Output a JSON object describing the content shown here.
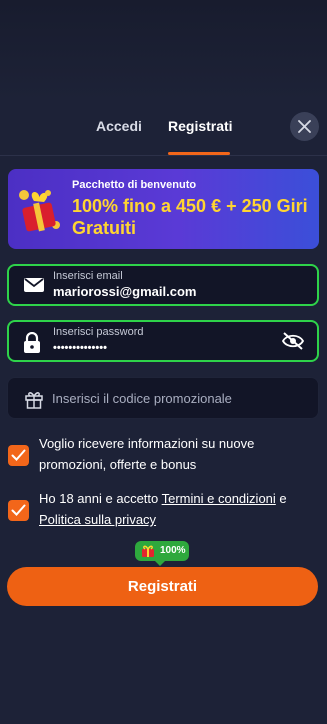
{
  "tabs": {
    "login_label": "Accedi",
    "register_label": "Registrati",
    "active": "register"
  },
  "promo": {
    "subtitle": "Pacchetto di benvenuto",
    "title": "100% fino a 450 € + 250 Giri Gratuiti"
  },
  "form": {
    "email": {
      "label": "Inserisci email",
      "value": "mariorossi@gmail.com"
    },
    "password": {
      "label": "Inserisci password",
      "value": "••••••••••••••"
    },
    "promo_code": {
      "placeholder": "Inserisci il codice promozionale"
    }
  },
  "consents": {
    "marketing_text": "Voglio ricevere informazioni su nuove promozioni, offerte e bonus",
    "terms_prefix": "Ho 18 anni e accetto ",
    "terms_link": "Termini e condizioni",
    "terms_and": " e ",
    "privacy_link": "Politica sulla privacy",
    "marketing_checked": true,
    "terms_checked": true
  },
  "bonus_badge": {
    "text": "100%"
  },
  "submit": {
    "label": "Registrati"
  },
  "colors": {
    "background": "#1d2237",
    "accent_orange": "#ee6113",
    "field_active_border": "#2ed34a",
    "promo_title": "#ffd531",
    "promo_gradient_start": "#4c2fc4"
  },
  "icons": [
    "close-icon",
    "gift-icon",
    "envelope-icon",
    "lock-icon",
    "eye-slash-icon",
    "checkmark-icon"
  ]
}
